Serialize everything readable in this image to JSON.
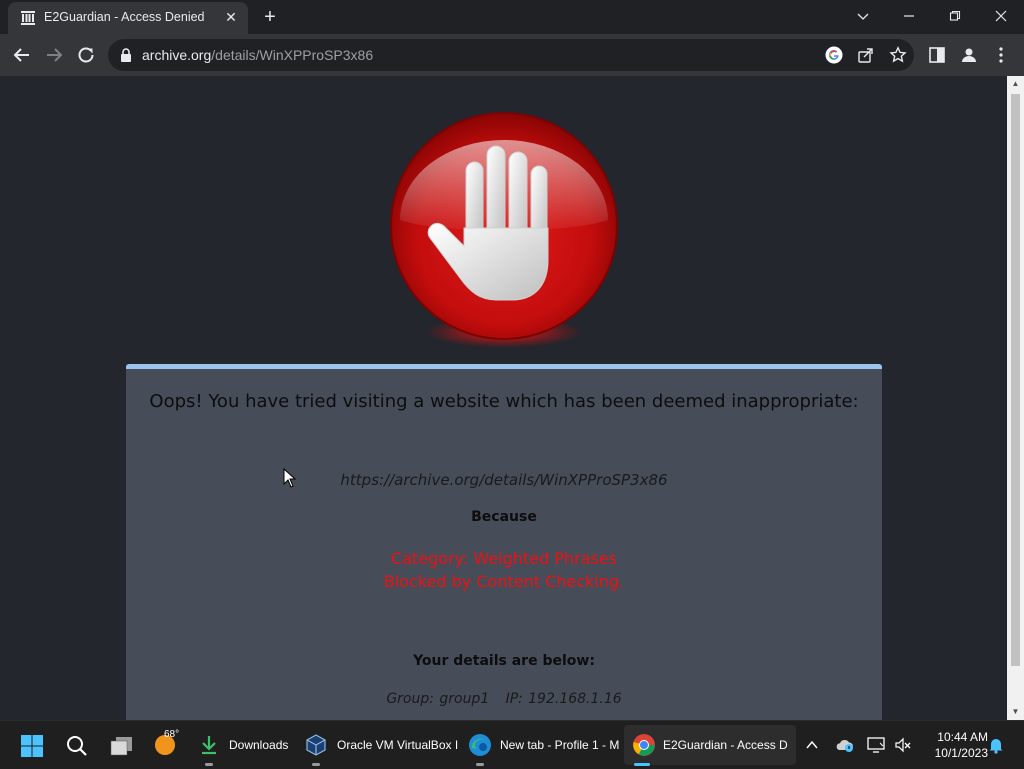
{
  "browser": {
    "tab_title": "E2Guardian - Access Denied",
    "url_host": "archive.org",
    "url_path": "/details/WinXPProSP3x86"
  },
  "page": {
    "heading": "Oops! You have tried visiting a website which has been deemed inappropriate:",
    "blocked_url": "https://archive.org/details/WinXPProSP3x86",
    "because": "Because",
    "category": "Category: Weighted Phrases",
    "reason": "Blocked by Content Checking.",
    "details_heading": "Your details are below:",
    "group": "Group: group1",
    "ip": "IP: 192.168.1.16"
  },
  "taskbar": {
    "weather_temp": "68°",
    "items": [
      {
        "label": "Downloads"
      },
      {
        "label": "Oracle VM VirtualBox I"
      },
      {
        "label": "New tab - Profile 1 - M"
      },
      {
        "label": "E2Guardian - Access D"
      }
    ],
    "time": "10:44 AM",
    "date": "10/1/2023"
  },
  "colors": {
    "page_bg": "#23262d",
    "panel_bg": "#474c59",
    "panel_border": "#9cc3ee",
    "reason_red": "#ee1111",
    "browser_dark": "#202124",
    "toolbar": "#35363a"
  },
  "icons": [
    "archive-favicon-icon",
    "close-icon",
    "plus-icon",
    "chevron-down-icon",
    "minimize-icon",
    "restore-icon",
    "back-icon",
    "forward-icon",
    "reload-icon",
    "lock-icon",
    "google-icon",
    "share-icon",
    "star-icon",
    "side-panel-icon",
    "profile-icon",
    "more-icon",
    "stop-hand-icon",
    "mouse-cursor-icon",
    "windows-start-icon",
    "search-icon",
    "task-view-icon",
    "weather-icon",
    "downloads-icon",
    "virtualbox-icon",
    "edge-icon",
    "chrome-icon",
    "chevron-up-icon",
    "onedrive-icon",
    "display-icon",
    "volume-muted-icon",
    "bell-icon"
  ]
}
